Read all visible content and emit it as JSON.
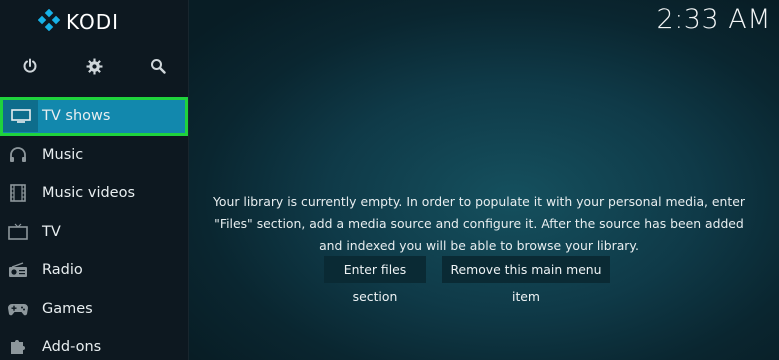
{
  "app": {
    "logo_text": "KODI"
  },
  "clock": {
    "time": "2:33 AM"
  },
  "top_icons": [
    {
      "name": "power-icon"
    },
    {
      "name": "gear-icon"
    },
    {
      "name": "search-icon"
    }
  ],
  "menu": {
    "items": [
      {
        "label": "TV shows",
        "icon": "tv-icon",
        "active": true
      },
      {
        "label": "Music",
        "icon": "headphones-icon"
      },
      {
        "label": "Music videos",
        "icon": "film-strip-icon"
      },
      {
        "label": "TV",
        "icon": "television-icon"
      },
      {
        "label": "Radio",
        "icon": "radio-icon"
      },
      {
        "label": "Games",
        "icon": "gamepad-icon"
      },
      {
        "label": "Add-ons",
        "icon": "addons-icon"
      }
    ]
  },
  "main": {
    "message_line1": "Your library is currently empty. In order to populate it with your personal media, enter",
    "message_line2": "\"Files\" section, add a media source and configure it. After the source has been added",
    "message_line3": "and indexed you will be able to browse your library.",
    "button_enter_files": "Enter files section",
    "button_remove_item": "Remove this main menu item"
  },
  "colors": {
    "accent": "#1288ad",
    "focus_outline": "#1fd23d",
    "sidebar_bg": "#0d1820"
  }
}
